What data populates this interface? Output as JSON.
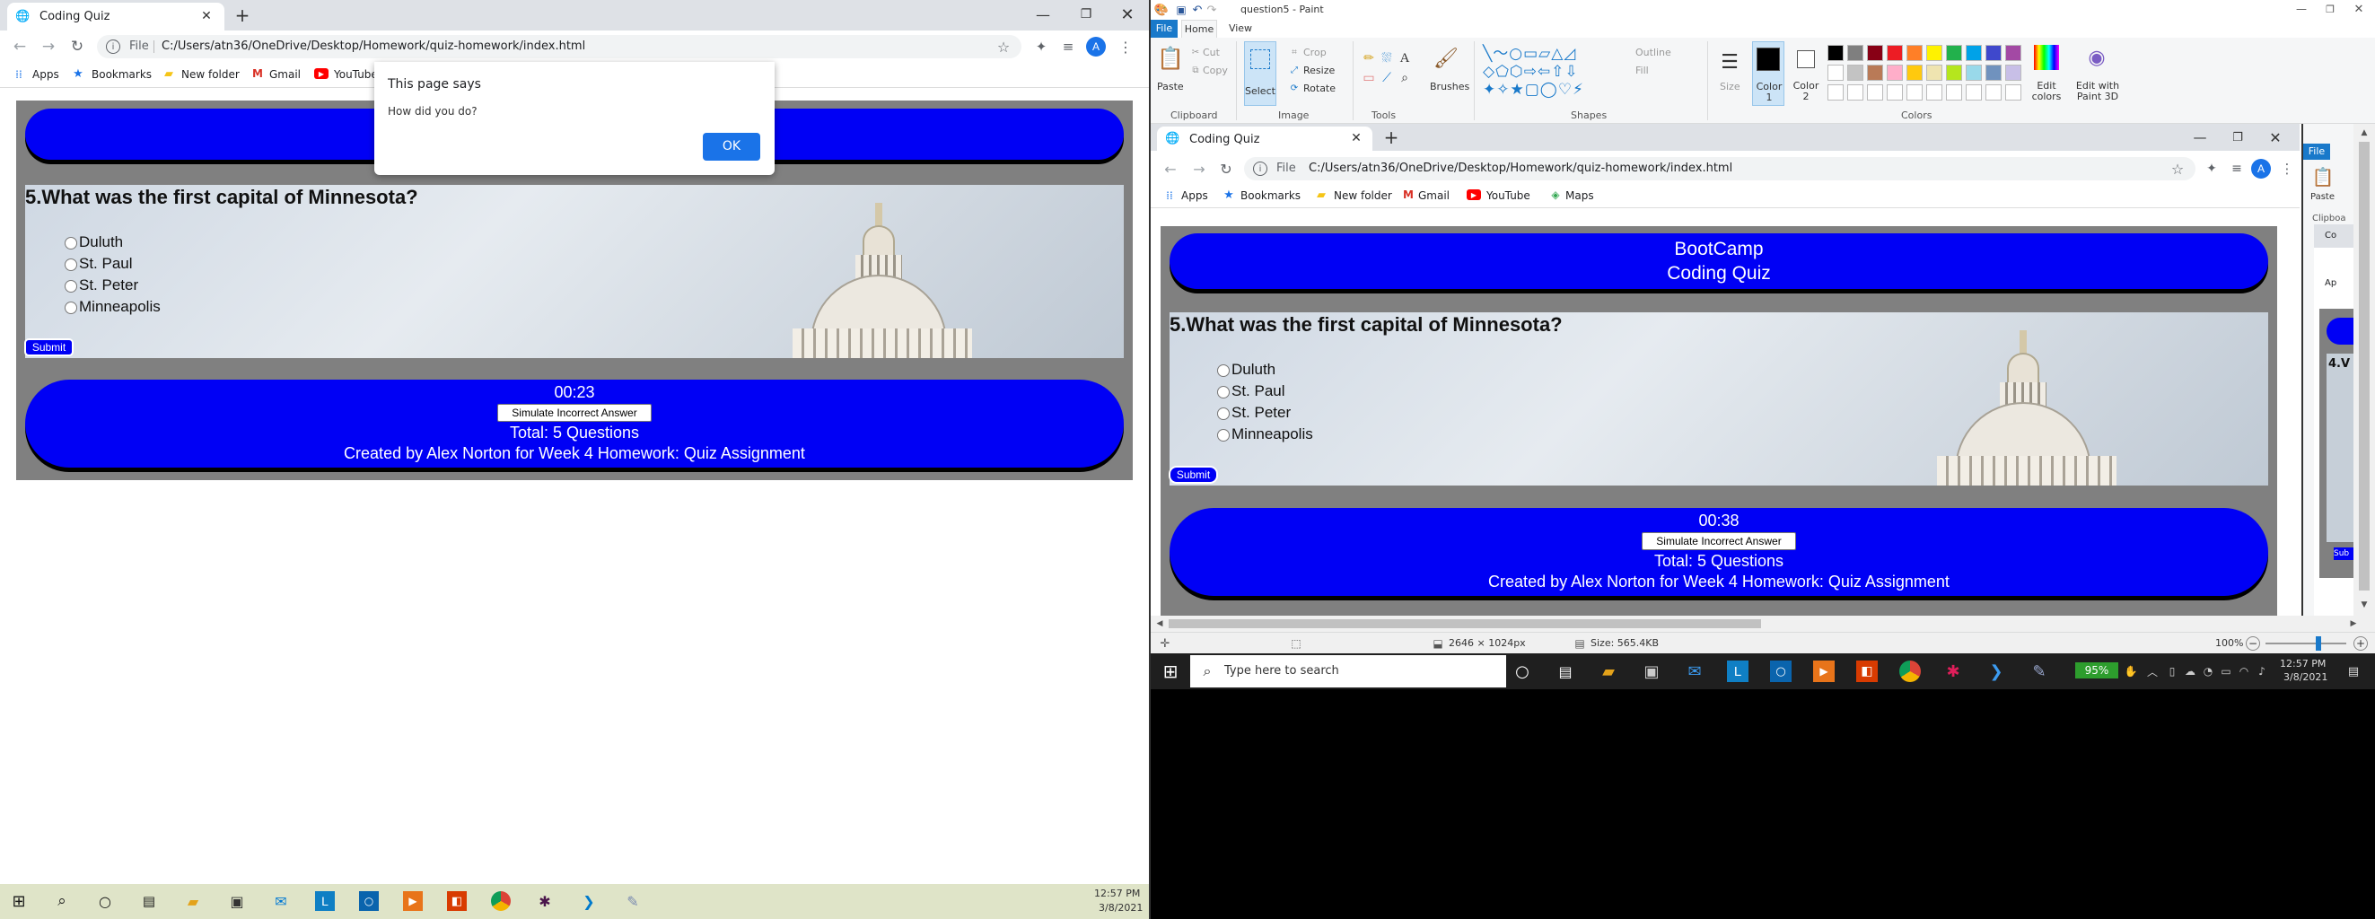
{
  "left": {
    "tab_title": "Coding Quiz",
    "address_prefix": "File",
    "url": "C:/Users/atn36/OneDrive/Desktop/Homework/quiz-homework/index.html",
    "bookmarks": {
      "apps": "Apps",
      "bookmarks": "Bookmarks",
      "new_folder": "New folder",
      "gmail": "Gmail",
      "youtube": "YouTube"
    },
    "dialog": {
      "title": "This page says",
      "message": "How did you do?",
      "ok": "OK"
    },
    "question": "5.What was the first capital of Minnesota?",
    "options": [
      "Duluth",
      "St. Paul",
      "St. Peter",
      "Minneapolis"
    ],
    "submit": "Submit",
    "timer": "00:23",
    "simulate": "Simulate Incorrect Answer",
    "total": "Total: 5 Questions",
    "credit": "Created by Alex Norton for Week 4 Homework: Quiz Assignment",
    "taskbar_time": "12:57 PM",
    "taskbar_date": "3/8/2021"
  },
  "paint": {
    "title": "question5 - Paint",
    "tabs": {
      "file": "File",
      "home": "Home",
      "view": "View"
    },
    "clipboard": {
      "paste": "Paste",
      "cut": "Cut",
      "copy": "Copy",
      "group": "Clipboard"
    },
    "image": {
      "select": "Select",
      "crop": "Crop",
      "resize": "Resize",
      "rotate": "Rotate",
      "group": "Image"
    },
    "tools_group": "Tools",
    "brushes": "Brushes",
    "shapes": {
      "outline": "Outline",
      "fill": "Fill",
      "group": "Shapes"
    },
    "size": "Size",
    "color1": "Color 1",
    "color2": "Color 2",
    "colors_group": "Colors",
    "edit_colors": "Edit colors",
    "edit_3d": "Edit with Paint 3D",
    "status": {
      "dims": "2646 × 1024px",
      "size": "Size: 565.4KB",
      "zoom": "100%"
    },
    "palette": [
      "#000000",
      "#7f7f7f",
      "#880015",
      "#ed1c24",
      "#ff7f27",
      "#fff200",
      "#22b14c",
      "#00a2e8",
      "#3f48cc",
      "#a349a4",
      "#ffffff",
      "#c3c3c3",
      "#b97a57",
      "#ffaec9",
      "#ffc90e",
      "#efe4b0",
      "#b5e61d",
      "#99d9ea",
      "#7092be",
      "#c8bfe7"
    ]
  },
  "inner": {
    "tab_title": "Coding Quiz",
    "address_prefix": "File",
    "url": "C:/Users/atn36/OneDrive/Desktop/Homework/quiz-homework/index.html",
    "bookmarks": {
      "apps": "Apps",
      "bookmarks": "Bookmarks",
      "new_folder": "New folder",
      "gmail": "Gmail",
      "youtube": "YouTube",
      "maps": "Maps"
    },
    "header1": "BootCamp",
    "header2": "Coding Quiz",
    "question": "5.What was the first capital of Minnesota?",
    "options": [
      "Duluth",
      "St. Paul",
      "St. Peter",
      "Minneapolis"
    ],
    "submit": "Submit",
    "timer": "00:38",
    "simulate": "Simulate Incorrect Answer",
    "total": "Total: 5 Questions",
    "credit": "Created by Alex Norton for Week 4 Homework: Quiz Assignment",
    "nested_file": "File",
    "nested_paste": "Paste",
    "nested_clip": "Clipboa",
    "nested_tab": "Co",
    "nested_apps": "Ap",
    "nested_q": "4.V",
    "nested_sub": "Sub"
  },
  "taskbar2": {
    "search": "Type here to search",
    "battery": "95%",
    "time": "12:57 PM",
    "date": "3/8/2021"
  }
}
